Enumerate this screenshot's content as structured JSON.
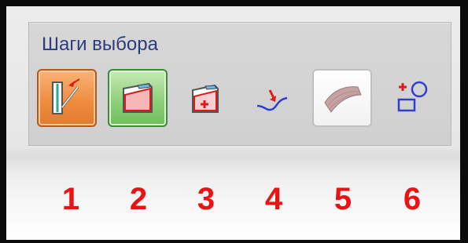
{
  "panel": {
    "title": "Шаги выбора"
  },
  "tools": [
    {
      "icon": "select-edge-icon",
      "state": "active-orange"
    },
    {
      "icon": "select-face-icon",
      "state": "active-green"
    },
    {
      "icon": "add-face-icon",
      "state": "normal"
    },
    {
      "icon": "select-curve-icon",
      "state": "normal"
    },
    {
      "icon": "select-surface-icon",
      "state": "highlighted"
    },
    {
      "icon": "add-shape-icon",
      "state": "normal"
    }
  ],
  "step_numbers": [
    "1",
    "2",
    "3",
    "4",
    "5",
    "6"
  ],
  "colors": {
    "frame": "#0b0b0b",
    "panel": "#d3d3d3",
    "title_text": "#2c3d7c",
    "step_number": "#ea1212",
    "active_orange": "#ef8a3c",
    "active_green": "#8fd07a"
  }
}
